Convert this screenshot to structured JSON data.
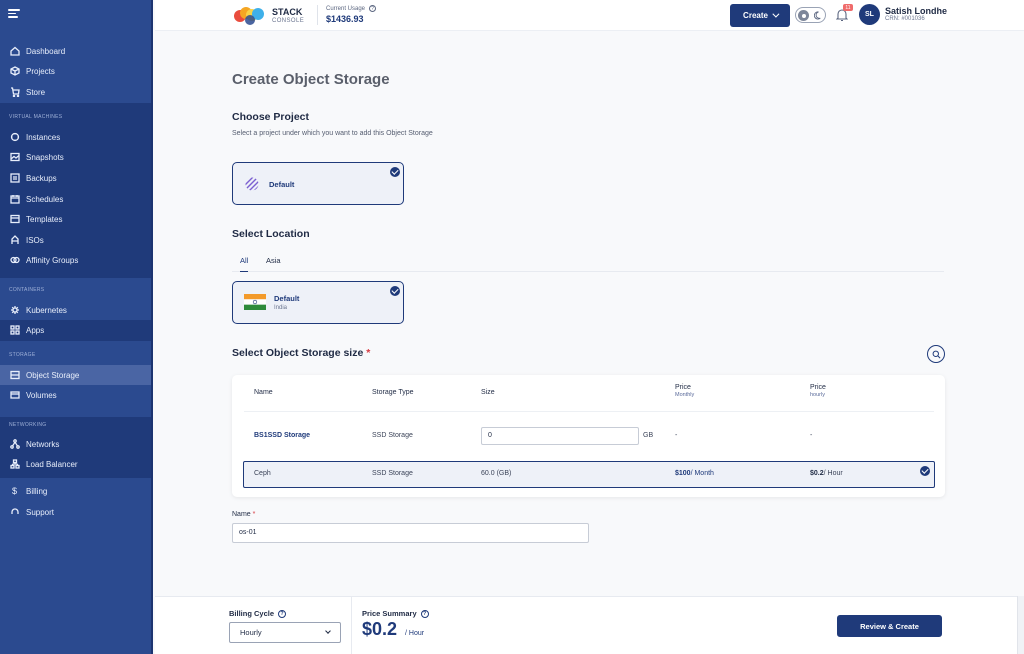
{
  "sidebar": {
    "items": [
      {
        "label": "Dashboard",
        "icon": "home-icon"
      },
      {
        "label": "Projects",
        "icon": "cube-icon"
      },
      {
        "label": "Store",
        "icon": "cart-icon"
      },
      {
        "label": "Instances",
        "icon": "server-icon"
      },
      {
        "label": "Snapshots",
        "icon": "image-icon"
      },
      {
        "label": "Backups",
        "icon": "backup-icon"
      },
      {
        "label": "Schedules",
        "icon": "calendar-icon"
      },
      {
        "label": "Templates",
        "icon": "template-icon"
      },
      {
        "label": "ISOs",
        "icon": "disc-icon"
      },
      {
        "label": "Affinity Groups",
        "icon": "affinity-icon"
      },
      {
        "label": "Kubernetes",
        "icon": "kubernetes-icon"
      },
      {
        "label": "Apps",
        "icon": "apps-icon"
      },
      {
        "label": "Object Storage",
        "icon": "storage-icon"
      },
      {
        "label": "Volumes",
        "icon": "volume-icon"
      },
      {
        "label": "Networks",
        "icon": "network-icon"
      },
      {
        "label": "Load Balancer",
        "icon": "load-balancer-icon"
      },
      {
        "label": "Billing",
        "icon": "dollar-icon"
      },
      {
        "label": "Support",
        "icon": "support-icon"
      }
    ],
    "sections": {
      "virtual_machines": "VIRTUAL MACHINES",
      "containers": "CONTAINERS",
      "storage": "STORAGE",
      "networking": "NETWORKING"
    }
  },
  "topbar": {
    "brand": "STACK",
    "brand_sub": "CONSOLE",
    "usage_label": "Current Usage",
    "usage_value": "$1436.93",
    "create_label": "Create",
    "notification_count": "11",
    "avatar_initials": "SL",
    "user_name": "Satish Londhe",
    "user_crn": "CRN: #001036"
  },
  "page": {
    "title": "Create Object Storage",
    "project_heading": "Choose Project",
    "project_desc": "Select a project under which you want to add this Object Storage",
    "project_card": "Default",
    "location_heading": "Select Location",
    "tabs": [
      "All",
      "Asia"
    ],
    "location_card_title": "Default",
    "location_card_sub": "India",
    "size_heading": "Select Object Storage size",
    "required_mark": "*"
  },
  "table": {
    "headers": {
      "name": "Name",
      "type": "Storage Type",
      "size": "Size",
      "price_m": "Price",
      "price_m_sub": "Monthly",
      "price_h": "Price",
      "price_h_sub": "hourly"
    },
    "row1": {
      "name": "BS1SSD Storage",
      "type": "SSD Storage",
      "size_value": "0",
      "size_unit": "GB",
      "price_m": "-",
      "price_h": "-"
    },
    "row2": {
      "name": "Ceph",
      "type": "SSD Storage",
      "size": "60.0 (GB)",
      "price_m_amount": "$100",
      "price_m_unit": "/ Month",
      "price_h_amount": "$0.2",
      "price_h_unit": "/ Hour"
    }
  },
  "name_field": {
    "label": "Name",
    "required_mark": "*",
    "value": "os-01"
  },
  "footer": {
    "billing_cycle_label": "Billing Cycle",
    "billing_cycle_value": "Hourly",
    "price_summary_label": "Price Summary",
    "price_value": "$0.2",
    "price_unit": "/ Hour",
    "review_label": "Review & Create",
    "help_glyph": "?"
  },
  "colors": {
    "primary": "#1f3a7a",
    "sidebar": "#2b4a8f",
    "required": "#d6383f",
    "badge": "#ef6b6b"
  }
}
